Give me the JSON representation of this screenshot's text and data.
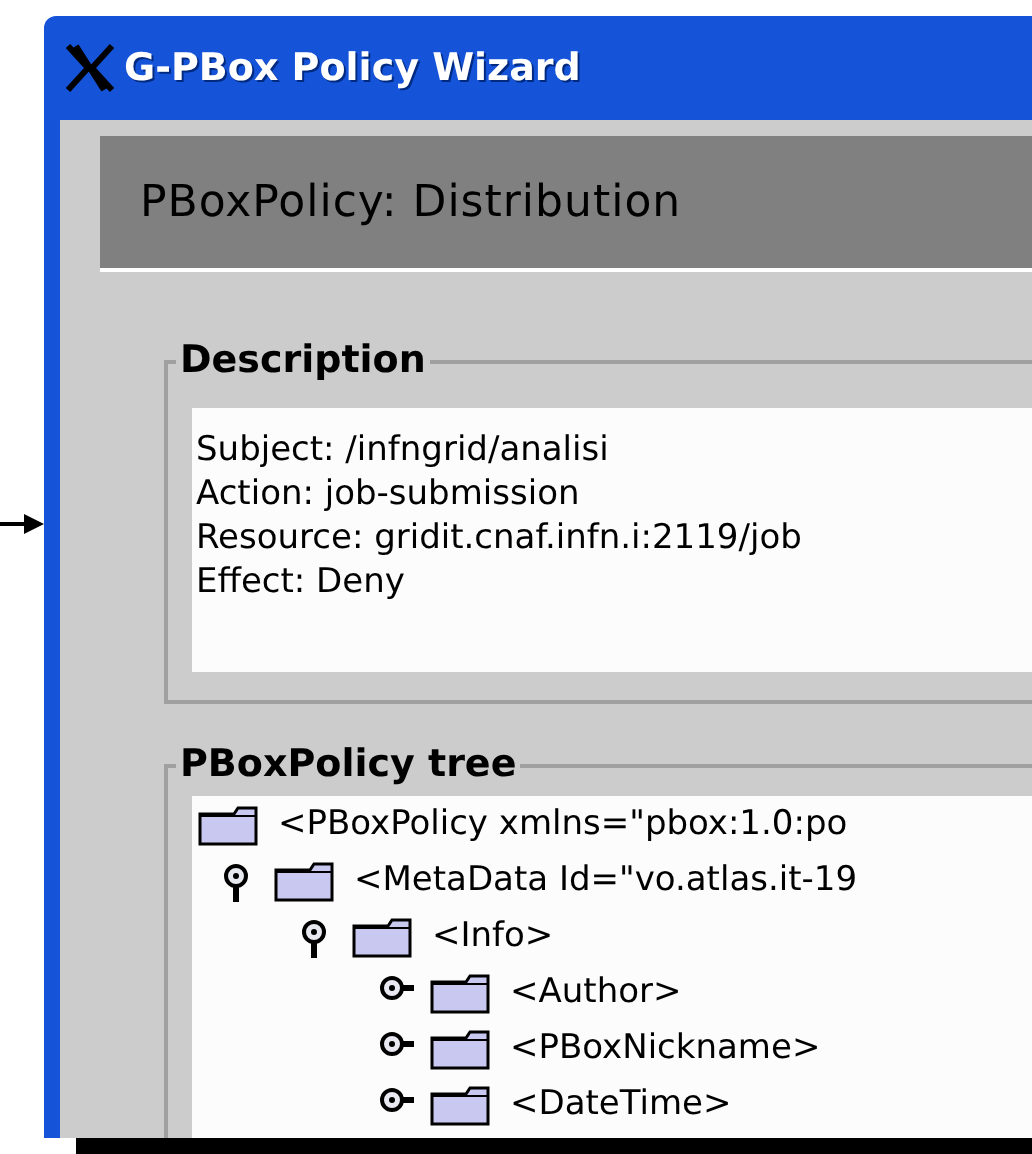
{
  "window": {
    "title": "G-PBox Policy Wizard"
  },
  "header": {
    "title": "PBoxPolicy: Distribution"
  },
  "description": {
    "label": "Description",
    "lines": [
      "Subject: /infngrid/analisi",
      "Action: job-submission",
      "Resource: gridit.cnaf.infn.i:2119/job",
      "Effect: Deny"
    ]
  },
  "tree": {
    "label": "PBoxPolicy tree",
    "nodes": [
      {
        "label": "<PBoxPolicy xmlns=\"pbox:1.0:po",
        "children": [
          {
            "label": "<MetaData Id=\"vo.atlas.it-19",
            "expanded": true,
            "children": [
              {
                "label": "<Info>",
                "expanded": true,
                "children": [
                  {
                    "label": "<Author>",
                    "expanded": false
                  },
                  {
                    "label": "<PBoxNickname>",
                    "expanded": false
                  },
                  {
                    "label": "<DateTime>",
                    "expanded": false
                  }
                ]
              }
            ]
          }
        ]
      }
    ]
  }
}
